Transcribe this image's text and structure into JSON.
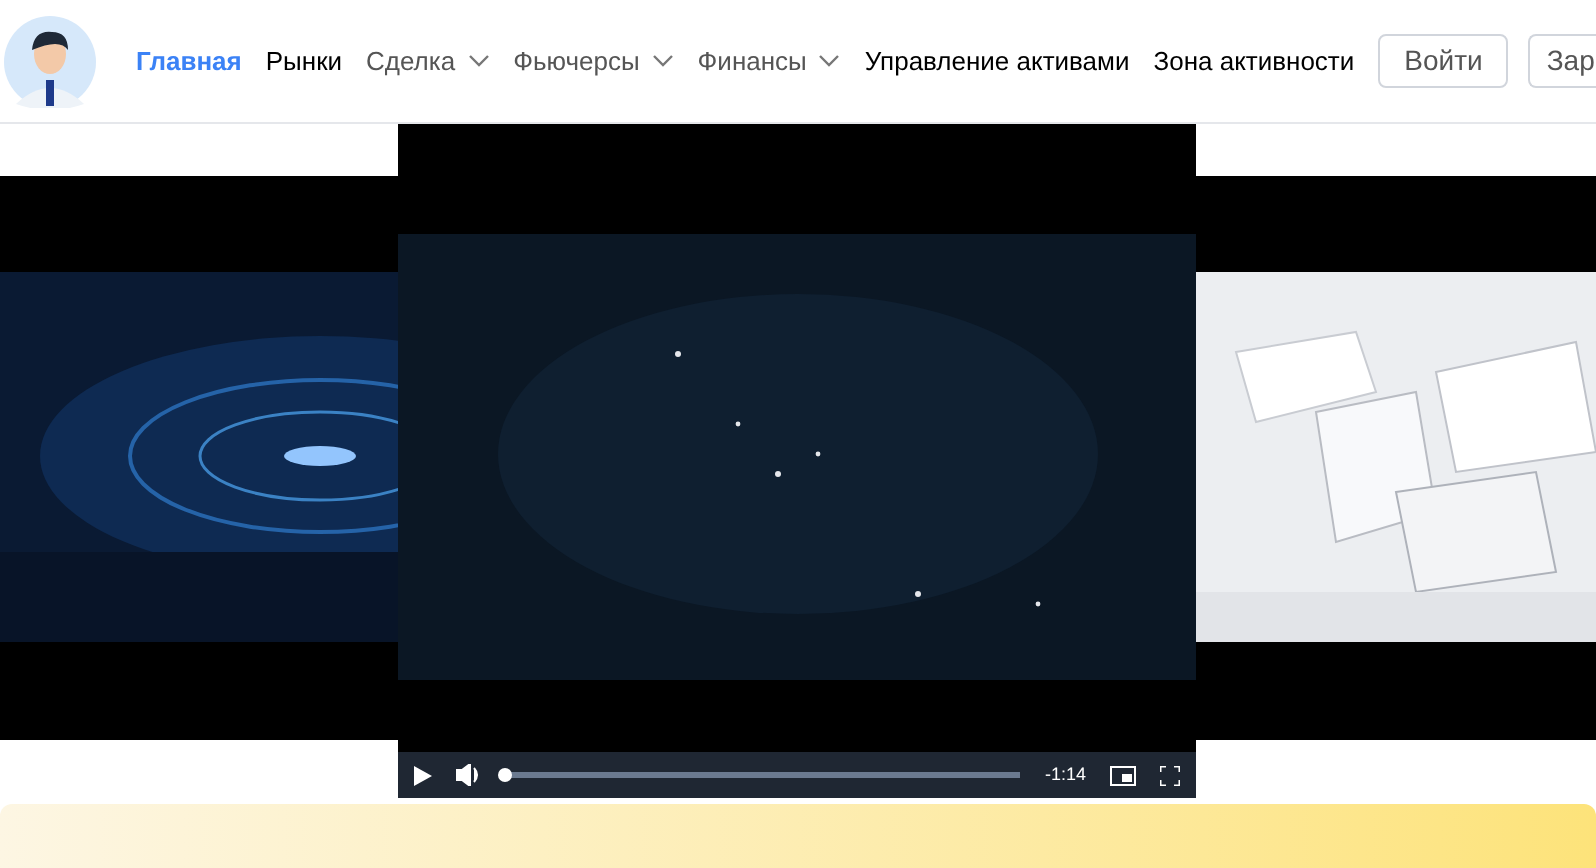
{
  "nav": [
    {
      "label": "Главная",
      "kind": "link",
      "selected": true
    },
    {
      "label": "Рынки",
      "kind": "link",
      "selected": false
    },
    {
      "label": "Сделка",
      "kind": "dropdown",
      "selected": false
    },
    {
      "label": "Фьючерсы",
      "kind": "dropdown",
      "selected": false
    },
    {
      "label": "Финансы",
      "kind": "dropdown",
      "selected": false
    },
    {
      "label": "Управление активами",
      "kind": "link",
      "selected": false
    },
    {
      "label": "Зона активности",
      "kind": "link",
      "selected": false
    }
  ],
  "buttons": [
    "Войти",
    "Зар"
  ],
  "carousel": {
    "slides": [
      {
        "kind": "picture"
      },
      {
        "kind": "video"
      },
      {
        "kind": "picture"
      }
    ]
  },
  "player": {
    "level": 0,
    "time": "-1:14"
  }
}
